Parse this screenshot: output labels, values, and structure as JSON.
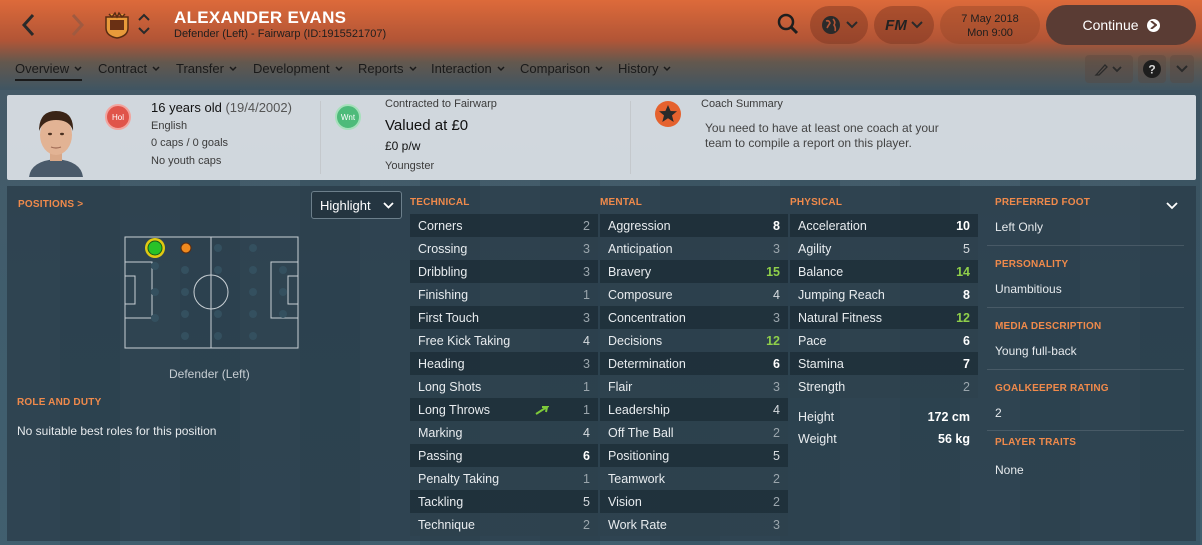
{
  "header": {
    "player_name": "ALEXANDER EVANS",
    "player_sub": "Defender (Left) - Fairwarp (ID:1915521707)",
    "date": "7 May 2018",
    "time": "Mon 9:00",
    "fm_label": "FM",
    "continue_label": "Continue"
  },
  "menu": [
    "Overview",
    "Contract",
    "Transfer",
    "Development",
    "Reports",
    "Interaction",
    "Comparison",
    "History"
  ],
  "profile": {
    "age": "16 years old",
    "dob": "(19/4/2002)",
    "nationality": "English",
    "caps": "0 caps / 0 goals",
    "youth_caps": "No youth caps",
    "badge1": "Hol",
    "badge2": "Wnt",
    "contract_label": "Contracted to Fairwarp",
    "value": "Valued at £0",
    "wage": "£0 p/w",
    "status": "Youngster",
    "coach_title": "Coach Summary",
    "coach_text1": "You need to have at least one coach at your",
    "coach_text2": "team to compile a report on this player."
  },
  "positions": {
    "title": "POSITIONS >",
    "highlight": "Highlight",
    "position_label": "Defender (Left)",
    "role_title": "ROLE AND DUTY",
    "role_text": "No suitable best roles for this position"
  },
  "technical": {
    "title": "TECHNICAL",
    "rows": [
      {
        "name": "Corners",
        "value": "2"
      },
      {
        "name": "Crossing",
        "value": "3"
      },
      {
        "name": "Dribbling",
        "value": "3"
      },
      {
        "name": "Finishing",
        "value": "1"
      },
      {
        "name": "First Touch",
        "value": "3"
      },
      {
        "name": "Free Kick Taking",
        "value": "4"
      },
      {
        "name": "Heading",
        "value": "3"
      },
      {
        "name": "Long Shots",
        "value": "1"
      },
      {
        "name": "Long Throws",
        "value": "1",
        "arrow": true
      },
      {
        "name": "Marking",
        "value": "4"
      },
      {
        "name": "Passing",
        "value": "6"
      },
      {
        "name": "Penalty Taking",
        "value": "1"
      },
      {
        "name": "Tackling",
        "value": "5"
      },
      {
        "name": "Technique",
        "value": "2"
      }
    ]
  },
  "mental": {
    "title": "MENTAL",
    "rows": [
      {
        "name": "Aggression",
        "value": "8"
      },
      {
        "name": "Anticipation",
        "value": "3"
      },
      {
        "name": "Bravery",
        "value": "15"
      },
      {
        "name": "Composure",
        "value": "4"
      },
      {
        "name": "Concentration",
        "value": "3"
      },
      {
        "name": "Decisions",
        "value": "12"
      },
      {
        "name": "Determination",
        "value": "6"
      },
      {
        "name": "Flair",
        "value": "3"
      },
      {
        "name": "Leadership",
        "value": "4"
      },
      {
        "name": "Off The Ball",
        "value": "2"
      },
      {
        "name": "Positioning",
        "value": "5"
      },
      {
        "name": "Teamwork",
        "value": "2"
      },
      {
        "name": "Vision",
        "value": "2"
      },
      {
        "name": "Work Rate",
        "value": "3"
      }
    ]
  },
  "physical": {
    "title": "PHYSICAL",
    "rows": [
      {
        "name": "Acceleration",
        "value": "10"
      },
      {
        "name": "Agility",
        "value": "5"
      },
      {
        "name": "Balance",
        "value": "14"
      },
      {
        "name": "Jumping Reach",
        "value": "8"
      },
      {
        "name": "Natural Fitness",
        "value": "12"
      },
      {
        "name": "Pace",
        "value": "6"
      },
      {
        "name": "Stamina",
        "value": "7"
      },
      {
        "name": "Strength",
        "value": "2"
      }
    ]
  },
  "body": {
    "height_label": "Height",
    "height": "172 cm",
    "weight_label": "Weight",
    "weight": "56 kg"
  },
  "info": {
    "foot_title": "PREFERRED FOOT",
    "foot": "Left Only",
    "personality_title": "PERSONALITY",
    "personality": "Unambitious",
    "media_title": "MEDIA DESCRIPTION",
    "media": "Young full-back",
    "gk_title": "GOALKEEPER RATING",
    "gk": "2",
    "traits_title": "PLAYER TRAITS",
    "traits": "None"
  },
  "colors": {
    "accent": "#f08a4b",
    "green": "#8fcf4a",
    "header_orange": "#dd6a3a"
  }
}
